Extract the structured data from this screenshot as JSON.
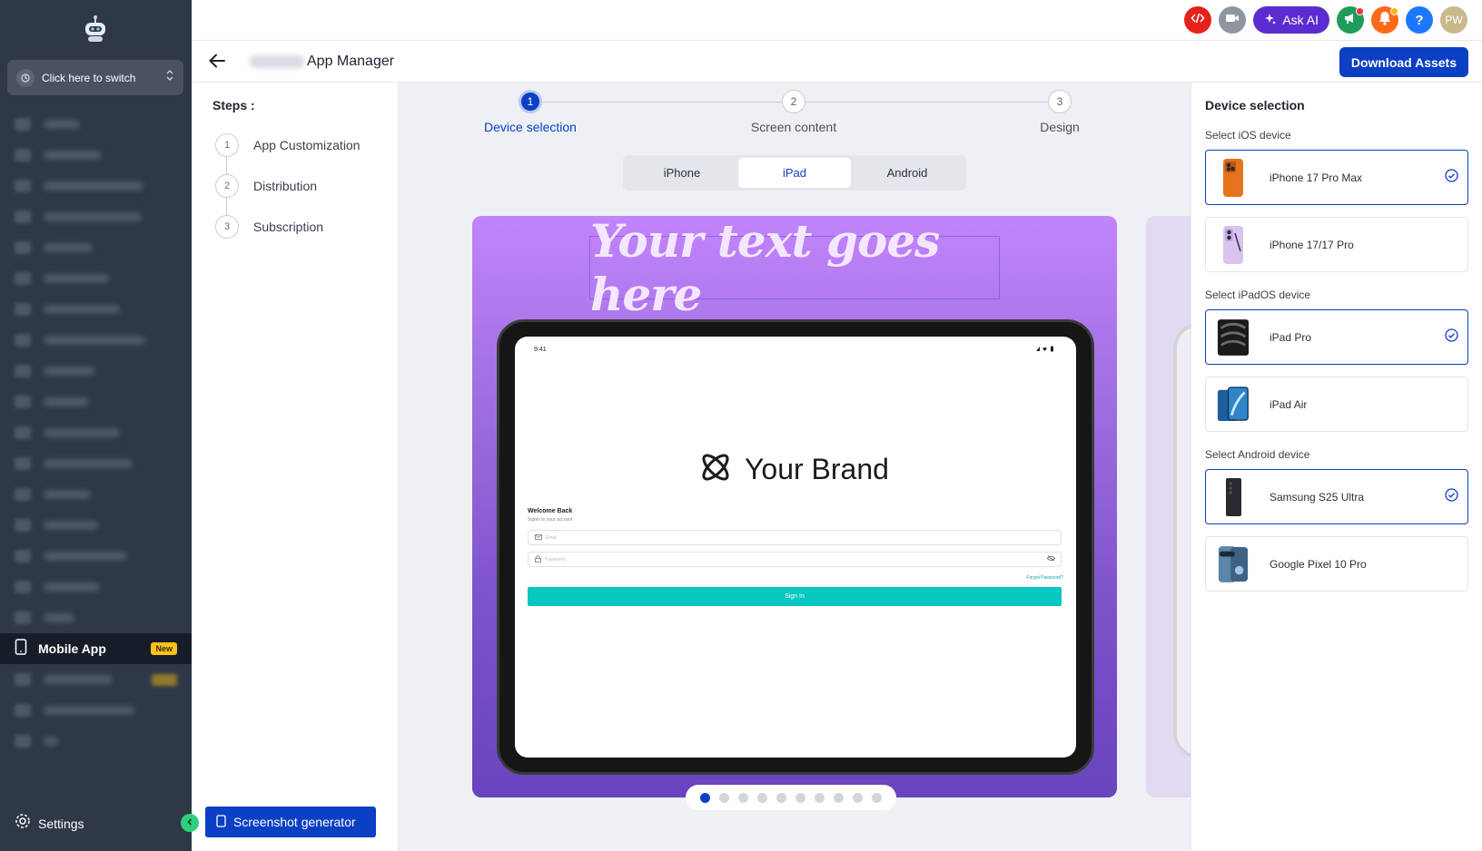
{
  "sidebar": {
    "switcher_label": "Click here to switch",
    "active_item": {
      "label": "Mobile App",
      "badge": "New"
    },
    "settings_label": "Settings"
  },
  "topbar": {
    "ask_ai_label": "Ask AI",
    "avatar_initials": "PW"
  },
  "header": {
    "title": "App Manager",
    "download_label": "Download Assets"
  },
  "steps": {
    "title": "Steps :",
    "items": [
      {
        "num": "1",
        "label": "App Customization"
      },
      {
        "num": "2",
        "label": "Distribution"
      },
      {
        "num": "3",
        "label": "Subscription"
      }
    ],
    "screenshot_button": "Screenshot generator"
  },
  "stepper": [
    {
      "num": "1",
      "label": "Device selection"
    },
    {
      "num": "2",
      "label": "Screen content"
    },
    {
      "num": "3",
      "label": "Design"
    }
  ],
  "platform_tabs": [
    "iPhone",
    "iPad",
    "Android"
  ],
  "active_tab": "iPad",
  "preview": {
    "headline": "Your text goes here",
    "status_time": "9:41",
    "brand_name": "Your Brand",
    "welcome_title": "Welcome Back",
    "welcome_sub": "Signin to your account",
    "email_placeholder": "Email",
    "password_placeholder": "Password",
    "forgot": "Forgot Password?",
    "signin": "Sign In"
  },
  "pagination": {
    "total": 10,
    "active": 1
  },
  "device_panel": {
    "title": "Device selection",
    "ios_label": "Select iOS device",
    "ipados_label": "Select iPadOS device",
    "android_label": "Select Android device",
    "ios": [
      {
        "name": "iPhone 17 Pro Max",
        "selected": true
      },
      {
        "name": "iPhone 17/17 Pro",
        "selected": false
      }
    ],
    "ipados": [
      {
        "name": "iPad Pro",
        "selected": true
      },
      {
        "name": "iPad Air",
        "selected": false
      }
    ],
    "android": [
      {
        "name": "Samsung S25 Ultra",
        "selected": true
      },
      {
        "name": "Google Pixel 10 Pro",
        "selected": false
      }
    ]
  },
  "colors": {
    "primary": "#0b3fc4",
    "sidebar": "#2f3847",
    "teal": "#07c7c0",
    "badge": "#ffc21a"
  }
}
